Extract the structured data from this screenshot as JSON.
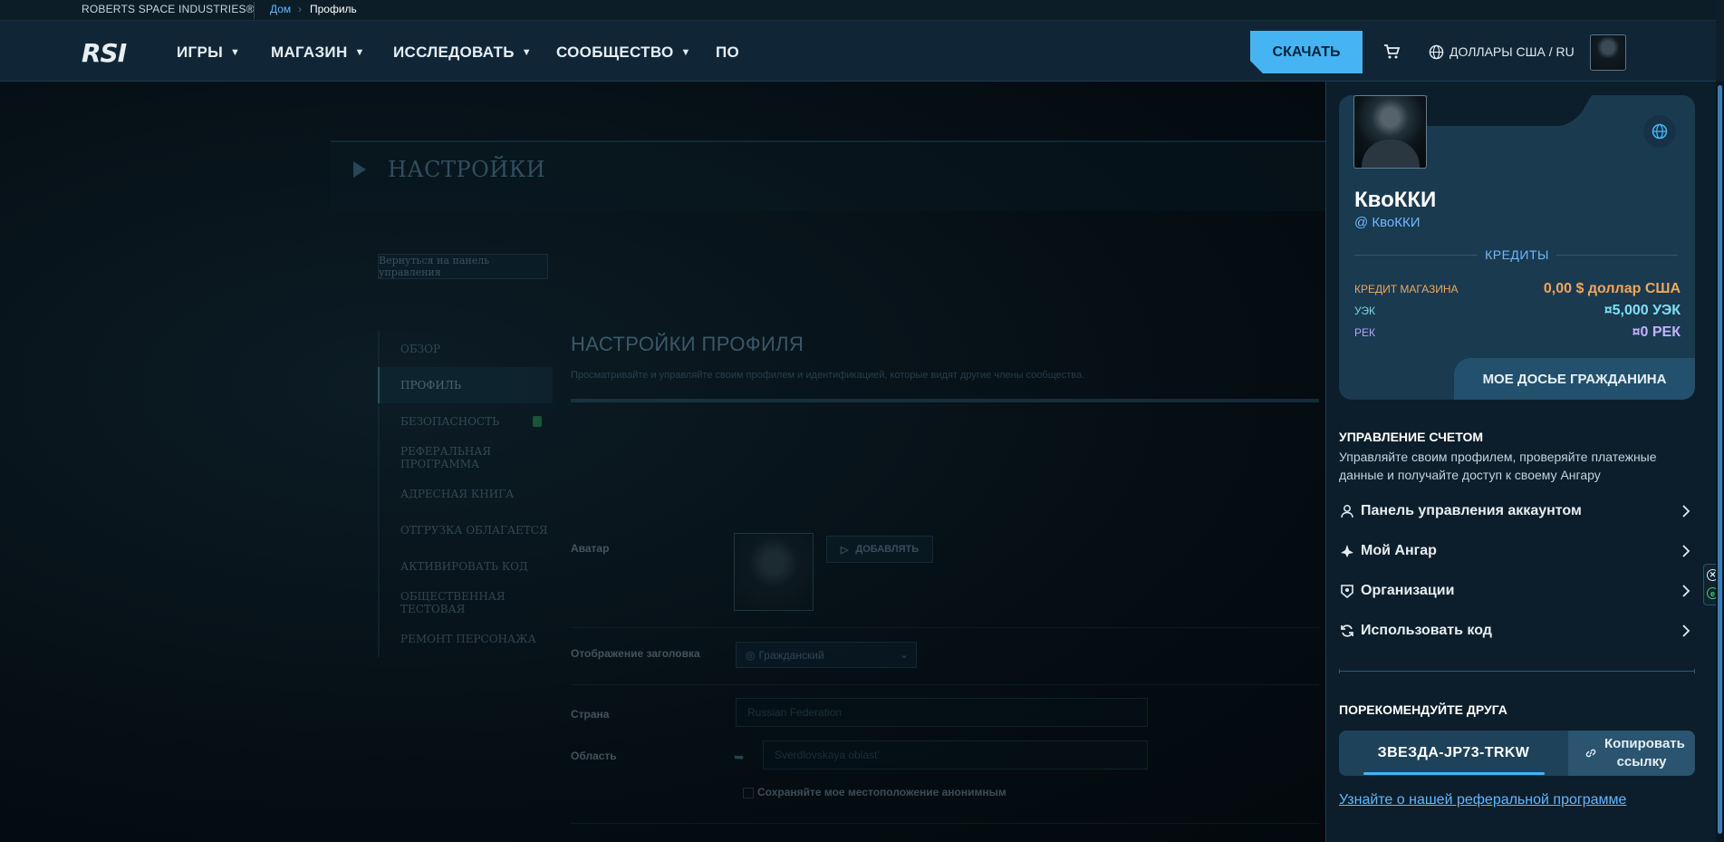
{
  "topbar": {
    "brand": "ROBERTS SPACE INDUSTRIES®",
    "breadcrumb_home": "Дом",
    "breadcrumb_sep": "›",
    "breadcrumb_current": "Профиль"
  },
  "nav": {
    "logo": "RSI",
    "items": [
      {
        "label": "ИГРЫ"
      },
      {
        "label": "МАГАЗИН"
      },
      {
        "label": "ИССЛЕДОВАТЬ"
      },
      {
        "label": "СООБЩЕСТВО"
      },
      {
        "label": "ПО"
      }
    ],
    "download_label": "СКАЧАТЬ",
    "currency_label": "ДОЛЛАРЫ США / RU",
    "icons": {
      "cart": "cart-icon",
      "globe": "globe-icon"
    }
  },
  "settings": {
    "title": "НАСТРОЙКИ",
    "back_label": "Вернуться на панель управления",
    "menu": [
      {
        "label": "ОБЗОР"
      },
      {
        "label": "ПРОФИЛЬ"
      },
      {
        "label": "БЕЗОПАСНОСТЬ"
      },
      {
        "label": "РЕФЕРАЛЬНАЯ ПРОГРАММА"
      },
      {
        "label": "АДРЕСНАЯ КНИГА"
      },
      {
        "label": "ОТГРУЗКА ОБЛАГАЕТСЯ"
      },
      {
        "label": "АКТИВИРОВАТЬ КОД"
      },
      {
        "label": "ОБЩЕСТВЕННАЯ ТЕСТОВАЯ"
      },
      {
        "label": "РЕМОНТ ПЕРСОНАЖА"
      }
    ],
    "profile_title": "НАСТРОЙКИ ПРОФИЛЯ",
    "profile_subtitle": "Просматривайте и управляйте своим профилем и идентификацией, которые видят другие члены сообщества.",
    "avatar_label": "Аватар",
    "add_label": "ДОБАВЛЯТЬ",
    "header_display_label": "Отображение заголовка",
    "header_display_value": "Гражданский",
    "country_label": "Страна",
    "country_value": "Russian Federation",
    "region_label": "Область",
    "region_value": "Sverdlovskaya oblast'",
    "anon_label": "Сохраняйте мое местоположение анонимным"
  },
  "panel": {
    "display_name": "КвоККИ",
    "handle": "@ КвоККИ",
    "credits_title": "КРЕДИТЫ",
    "credits": [
      {
        "key": "КРЕДИТ МАГАЗИНА",
        "value": "0,00 $ доллар США",
        "key_color": "#f2a65a",
        "value_color": "#f2a65a"
      },
      {
        "key": "УЭК",
        "value": "¤5,000 УЭК",
        "key_color": "#7fd6e6",
        "value_color": "#7fe0ef"
      },
      {
        "key": "РЕК",
        "value": "¤0 РЕК",
        "key_color": "#b9a3ff",
        "value_color": "#c4b0ff"
      }
    ],
    "dossier_label": "МОЕ ДОСЬЕ ГРАЖДАНИНА",
    "account_title": "УПРАВЛЕНИЕ СЧЕТОМ",
    "account_desc": "Управляйте своим профилем, проверяйте платежные данные и получайте доступ к своему Ангару",
    "menu": [
      {
        "label": "Панель управления аккаунтом",
        "icon": "user-icon"
      },
      {
        "label": "Мой Ангар",
        "icon": "ship-icon"
      },
      {
        "label": "Организации",
        "icon": "organization-icon"
      },
      {
        "label": "Использовать код",
        "icon": "redeem-icon"
      }
    ],
    "refer_title": "ПОРЕКОМЕНДУЙТЕ ДРУГА",
    "referral_code": "ЗВЕЗДА-JP73-TRKW",
    "copy_label": "Копировать ссылку",
    "refer_link": "Узнайте о нашей реферальной программе"
  },
  "colors": {
    "accent": "#46b4f3",
    "link": "#5fb7ff",
    "panel_bg": "#0c1e2b",
    "card_bg": "#1a3a50"
  }
}
